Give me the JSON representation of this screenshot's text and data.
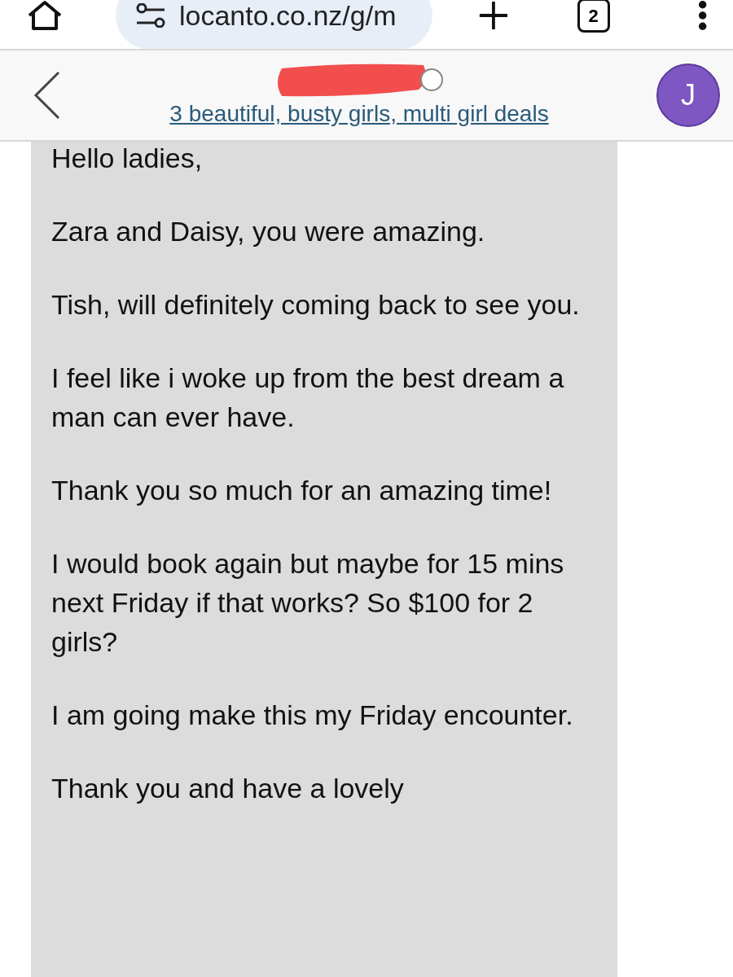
{
  "browser": {
    "url": "locanto.co.nz/g/m",
    "tab_count": "2"
  },
  "conversation": {
    "subject": "3 beautiful, busty girls, multi girl deals",
    "avatar_letter": "J",
    "online": false
  },
  "message": {
    "paragraphs": [
      "Hello ladies,",
      "Zara and Daisy, you were amazing.",
      "Tish, will definitely coming back to see you.",
      "I feel like i woke up from the best dream a man can ever have.",
      "Thank you so much for an amazing time!",
      "I would book again but maybe for 15 mins next Friday if that works? So $100 for 2 girls?",
      "I am going make this my Friday encounter.",
      "Thank you and have a lovely"
    ]
  }
}
